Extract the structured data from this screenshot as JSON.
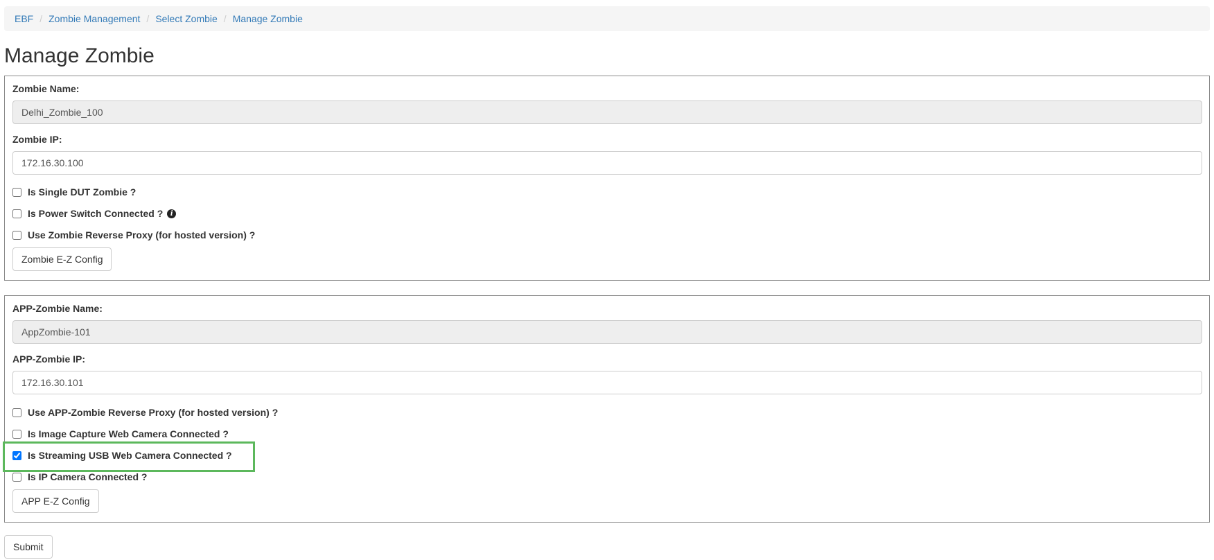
{
  "breadcrumb": {
    "items": [
      "EBF",
      "Zombie Management",
      "Select Zombie",
      "Manage Zombie"
    ],
    "separator": "/"
  },
  "title": "Manage Zombie",
  "zombie_panel": {
    "name_label": "Zombie Name:",
    "name_value": "Delhi_Zombie_100",
    "ip_label": "Zombie IP:",
    "ip_value": "172.16.30.100",
    "checks": [
      {
        "label": "Is Single DUT Zombie ?",
        "checked": false
      },
      {
        "label": "Is Power Switch Connected ?",
        "checked": false,
        "info_icon": "info-icon"
      },
      {
        "label": "Use Zombie Reverse Proxy (for hosted version) ?",
        "checked": false
      }
    ],
    "config_button": "Zombie E-Z Config"
  },
  "app_panel": {
    "name_label": "APP-Zombie Name:",
    "name_value": "AppZombie-101",
    "ip_label": "APP-Zombie IP:",
    "ip_value": "172.16.30.101",
    "checks": [
      {
        "label": "Use APP-Zombie Reverse Proxy (for hosted version) ?",
        "checked": false
      },
      {
        "label": "Is Image Capture Web Camera Connected ?",
        "checked": false
      },
      {
        "label": "Is Streaming USB Web Camera Connected ?",
        "checked": true
      },
      {
        "label": "Is IP Camera Connected ?",
        "checked": false
      }
    ],
    "config_button": "APP E-Z Config"
  },
  "submit_label": "Submit",
  "colors": {
    "link": "#337ab7",
    "highlight": "#5cb85c",
    "panel_border": "#8a8a8a",
    "readonly_bg": "#eeeeee"
  }
}
